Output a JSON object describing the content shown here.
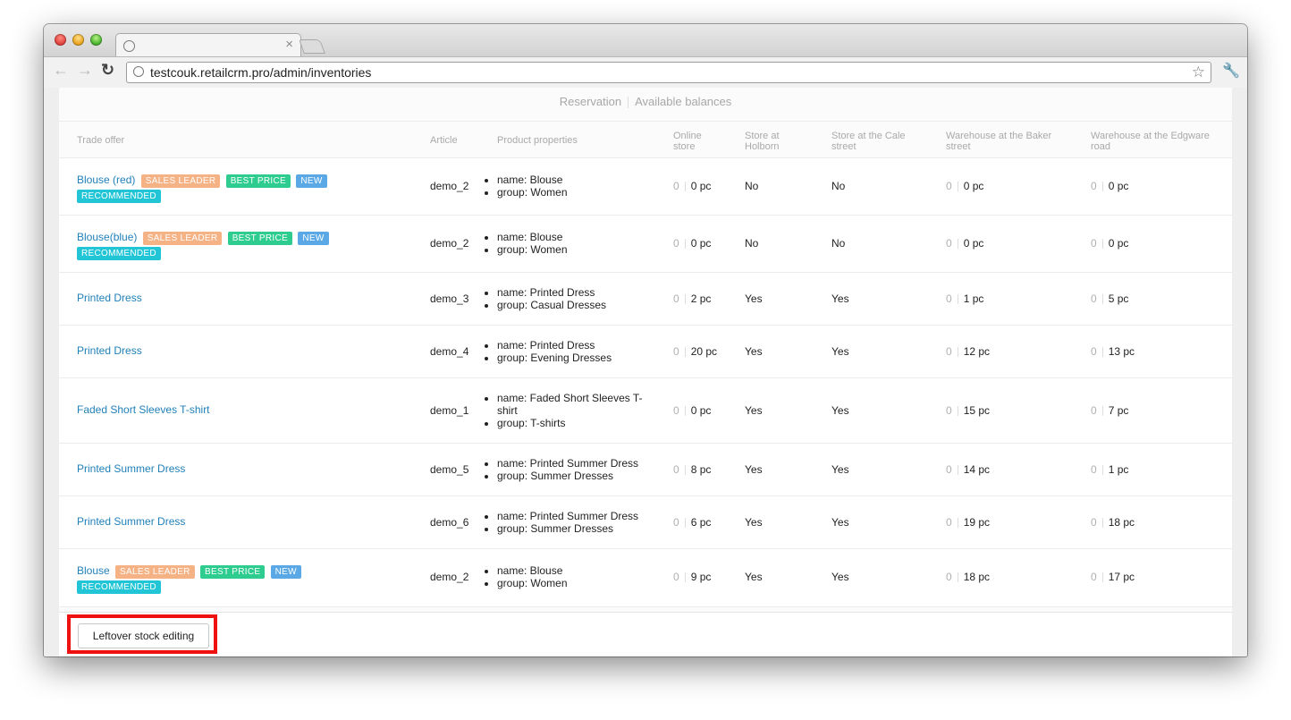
{
  "browser": {
    "url": "testcouk.retailcrm.pro/admin/inventories",
    "tab_close": "×"
  },
  "tabs": [
    "Reservation",
    "Available balances"
  ],
  "columns": {
    "trade_offer": "Trade offer",
    "article": "Article",
    "properties": "Product properties",
    "online_store": "Online store",
    "holborn": "Store at Holborn",
    "cale": "Store at the Cale street",
    "baker": "Warehouse at the Baker street",
    "edgware": "Warehouse at the Edgware road"
  },
  "badges": {
    "sales_leader": "SALES LEADER",
    "best_price": "BEST PRICE",
    "new": "NEW",
    "recommended": "RECOMMENDED"
  },
  "rows": [
    {
      "offer": "Blouse (red)",
      "article": "demo_2",
      "props": [
        "name: Blouse",
        "group: Women"
      ],
      "online": {
        "r": "0",
        "v": "0 pc"
      },
      "holborn": "No",
      "cale": "No",
      "baker": {
        "r": "0",
        "v": "0 pc"
      },
      "edgware": {
        "r": "0",
        "v": "0 pc"
      }
    },
    {
      "offer": "Blouse(blue)",
      "article": "demo_2",
      "props": [
        "name: Blouse",
        "group: Women"
      ],
      "online": {
        "r": "0",
        "v": "0 pc"
      },
      "holborn": "No",
      "cale": "No",
      "baker": {
        "r": "0",
        "v": "0 pc"
      },
      "edgware": {
        "r": "0",
        "v": "0 pc"
      }
    },
    {
      "offer": "Printed Dress",
      "article": "demo_3",
      "props": [
        "name: Printed Dress",
        "group: Casual Dresses"
      ],
      "online": {
        "r": "0",
        "v": "2 pc"
      },
      "holborn": "Yes",
      "cale": "Yes",
      "baker": {
        "r": "0",
        "v": "1 pc"
      },
      "edgware": {
        "r": "0",
        "v": "5 pc"
      }
    },
    {
      "offer": "Printed Dress",
      "article": "demo_4",
      "props": [
        "name: Printed Dress",
        "group: Evening Dresses"
      ],
      "online": {
        "r": "0",
        "v": "20 pc"
      },
      "holborn": "Yes",
      "cale": "Yes",
      "baker": {
        "r": "0",
        "v": "12 pc"
      },
      "edgware": {
        "r": "0",
        "v": "13 pc"
      }
    },
    {
      "offer": "Faded Short Sleeves T-shirt",
      "article": "demo_1",
      "props": [
        "name: Faded Short Sleeves T-shirt",
        "group: T-shirts"
      ],
      "online": {
        "r": "0",
        "v": "0 pc"
      },
      "holborn": "Yes",
      "cale": "Yes",
      "baker": {
        "r": "0",
        "v": "15 pc"
      },
      "edgware": {
        "r": "0",
        "v": "7 pc"
      }
    },
    {
      "offer": "Printed Summer Dress",
      "article": "demo_5",
      "props": [
        "name: Printed Summer Dress",
        "group: Summer Dresses"
      ],
      "online": {
        "r": "0",
        "v": "8 pc"
      },
      "holborn": "Yes",
      "cale": "Yes",
      "baker": {
        "r": "0",
        "v": "14 pc"
      },
      "edgware": {
        "r": "0",
        "v": "1 pc"
      }
    },
    {
      "offer": "Printed Summer Dress",
      "article": "demo_6",
      "props": [
        "name: Printed Summer Dress",
        "group: Summer Dresses"
      ],
      "online": {
        "r": "0",
        "v": "6 pc"
      },
      "holborn": "Yes",
      "cale": "Yes",
      "baker": {
        "r": "0",
        "v": "19 pc"
      },
      "edgware": {
        "r": "0",
        "v": "18 pc"
      }
    },
    {
      "offer": "Blouse",
      "article": "demo_2",
      "props": [
        "name: Blouse",
        "group: Women"
      ],
      "online": {
        "r": "0",
        "v": "9 pc"
      },
      "holborn": "Yes",
      "cale": "Yes",
      "baker": {
        "r": "0",
        "v": "18 pc"
      },
      "edgware": {
        "r": "0",
        "v": "17 pc"
      }
    }
  ],
  "footer": {
    "edit_button": "Leftover stock editing"
  }
}
